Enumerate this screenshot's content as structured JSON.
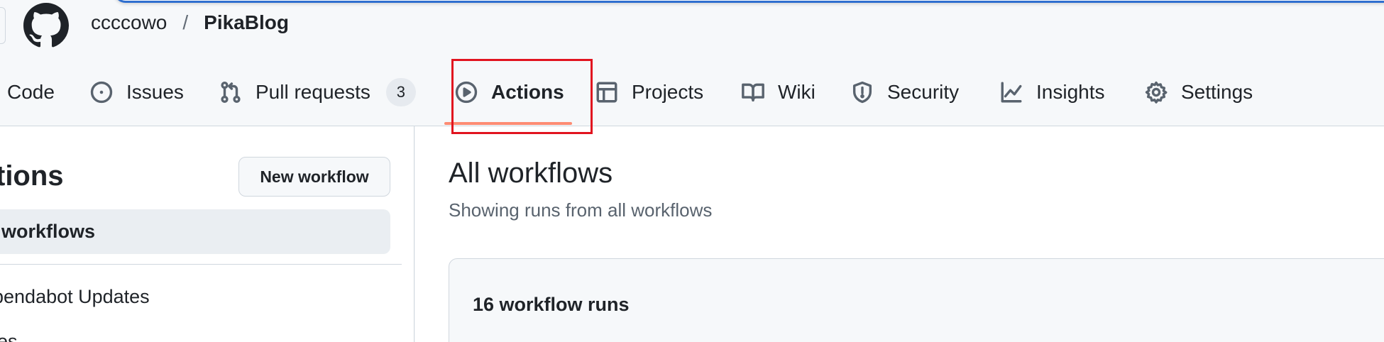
{
  "breadcrumb": {
    "owner": "ccccowo",
    "separator": "/",
    "repo": "PikaBlog"
  },
  "nav": {
    "tabs": [
      {
        "label": "Code",
        "icon": "code-icon"
      },
      {
        "label": "Issues",
        "icon": "issue-circle-icon"
      },
      {
        "label": "Pull requests",
        "icon": "pull-request-icon",
        "count": "3"
      },
      {
        "label": "Actions",
        "icon": "play-circle-icon",
        "active": true
      },
      {
        "label": "Projects",
        "icon": "table-icon"
      },
      {
        "label": "Wiki",
        "icon": "book-icon"
      },
      {
        "label": "Security",
        "icon": "shield-icon"
      },
      {
        "label": "Insights",
        "icon": "graph-icon"
      },
      {
        "label": "Settings",
        "icon": "gear-icon"
      }
    ]
  },
  "sidebar": {
    "title": "tions",
    "new_workflow_label": "New workflow",
    "active_item": "workflows",
    "items": [
      "pendabot Updates",
      "es"
    ]
  },
  "main": {
    "title": "All workflows",
    "subtitle": "Showing runs from all workflows",
    "runs_count": "16 workflow runs"
  },
  "colors": {
    "accent_underline": "#fd8c73",
    "highlight_box": "#e1141f",
    "focus_ring": "#2f6fcf"
  }
}
